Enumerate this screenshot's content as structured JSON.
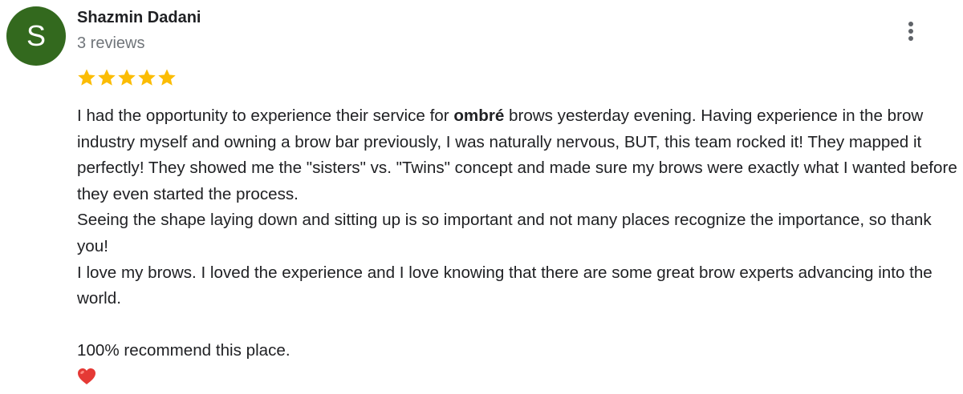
{
  "review": {
    "author": {
      "initial": "S",
      "name": "Shazmin Dadani",
      "review_count": "3 reviews",
      "avatar_color": "#33691e"
    },
    "rating": {
      "stars": 5,
      "max": 5,
      "star_color": "#fbbc04"
    },
    "menu_icon": "more-vert-icon",
    "body": {
      "p1_before": "I had the opportunity to experience their service for ",
      "p1_bold": "ombré",
      "p1_after": " brows yesterday evening. Having experience in the brow industry myself and owning a brow bar previously, I was naturally nervous, BUT, this team rocked it! They mapped it perfectly! They showed me the \"sisters\" vs. \"Twins\" concept and made sure my brows were exactly what I wanted before they even started the process.",
      "p2": "Seeing the shape laying down and sitting up is so important and not many places recognize the importance, so thank you!",
      "p3": "I love my brows. I loved the experience and I love knowing that there are some great brow experts advancing into the world.",
      "p4": "100% recommend this place.",
      "emoji": "red-heart-icon"
    }
  }
}
